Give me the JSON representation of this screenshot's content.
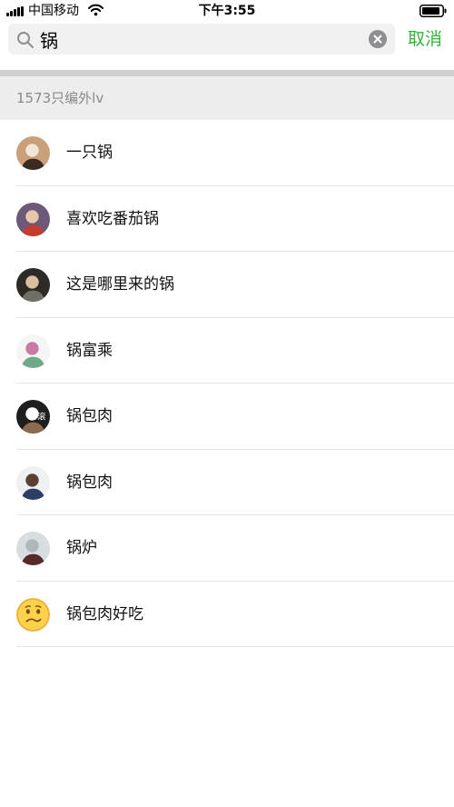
{
  "status_bar": {
    "carrier": "中国移动",
    "time": "下午3:55"
  },
  "search": {
    "query": "锅",
    "cancel_label": "取消"
  },
  "section": {
    "title": "1573只编外lv"
  },
  "results": [
    {
      "name": "一只锅",
      "avatar": {
        "bg": "#c9a07a",
        "fg": "#3b2a20",
        "accent": "#f2e6d8"
      }
    },
    {
      "name": "喜欢吃番茄锅",
      "avatar": {
        "bg": "#6b5a7a",
        "fg": "#c43c2c",
        "accent": "#e7c7a8"
      }
    },
    {
      "name": "这是哪里来的锅",
      "avatar": {
        "bg": "#2e2a26",
        "fg": "#6f6f68",
        "accent": "#d9c0a0"
      }
    },
    {
      "name": "锅富乘",
      "avatar": {
        "bg": "#f4f6f4",
        "fg": "#6fa98a",
        "accent": "#c77aa6"
      }
    },
    {
      "name": "锅包肉",
      "avatar": {
        "bg": "#1e1e1e",
        "fg": "#8a6a50",
        "accent": "#ffffff",
        "label": "滚"
      }
    },
    {
      "name": "锅包肉",
      "avatar": {
        "bg": "#eef0f2",
        "fg": "#2b3f66",
        "accent": "#5a4030"
      }
    },
    {
      "name": "锅炉",
      "avatar": {
        "bg": "#d8dde0",
        "fg": "#5a2a2a",
        "accent": "#b0b8bd"
      }
    },
    {
      "name": "锅包肉好吃",
      "avatar": {
        "type": "emoji",
        "bg": "#fbd24a",
        "fg": "#7a4a12",
        "accent": "#f0a93a"
      }
    }
  ]
}
